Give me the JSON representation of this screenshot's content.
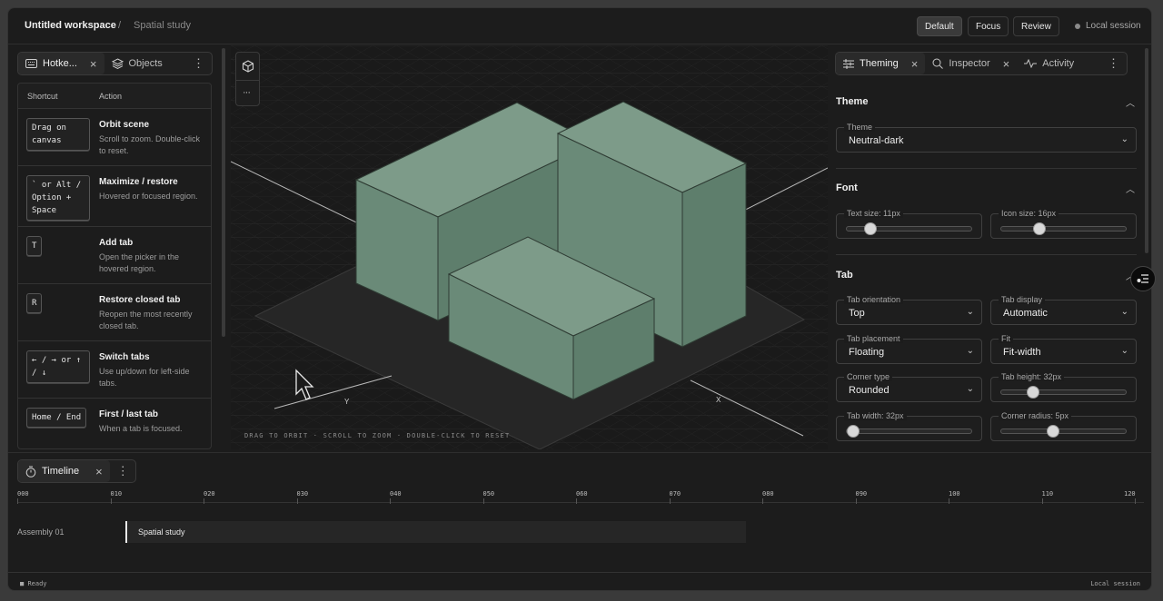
{
  "header": {
    "workspace": "Untitled workspace",
    "separator": "/",
    "project": "Spatial study",
    "modes": [
      "Default",
      "Focus",
      "Review"
    ],
    "session": "Local session"
  },
  "left": {
    "tabs": [
      {
        "label": "Hotke..."
      },
      {
        "label": "Objects"
      }
    ],
    "columns": {
      "shortcut": "Shortcut",
      "action": "Action"
    },
    "rows": [
      {
        "key": "Drag on canvas",
        "title": "Orbit scene",
        "desc": "Scroll to zoom. Double-click to reset."
      },
      {
        "key": "` or Alt / Option + Space",
        "title": "Maximize / restore",
        "desc": "Hovered or focused region."
      },
      {
        "key": "T",
        "title": "Add tab",
        "desc": "Open the picker in the hovered region."
      },
      {
        "key": "R",
        "title": "Restore closed tab",
        "desc": "Reopen the most recently closed tab."
      },
      {
        "key": "← / → or ↑ / ↓",
        "title": "Switch tabs",
        "desc": "Use up/down for left-side tabs."
      },
      {
        "key": "Home / End",
        "title": "First / last tab",
        "desc": "When a tab is focused."
      }
    ]
  },
  "viewport": {
    "hint": "DRAG TO ORBIT · SCROLL TO ZOOM · DOUBLE-CLICK TO RESET",
    "axis_x": "X",
    "axis_y": "Y",
    "box_color": "#6a8a78"
  },
  "right": {
    "tabs": [
      {
        "label": "Theming"
      },
      {
        "label": "Inspector"
      },
      {
        "label": "Activity"
      }
    ],
    "theme": {
      "title": "Theme",
      "field_label": "Theme",
      "value": "Neutral-dark"
    },
    "font": {
      "title": "Font",
      "text_size_label": "Text size: 11px",
      "text_size_level": 0.15,
      "icon_size_label": "Icon size: 16px",
      "icon_size_level": 0.28
    },
    "tab": {
      "title": "Tab",
      "orientation_label": "Tab orientation",
      "orientation": "Top",
      "display_label": "Tab display",
      "display": "Automatic",
      "placement_label": "Tab placement",
      "placement": "Floating",
      "fit_label": "Fit",
      "fit": "Fit-width",
      "corner_label": "Corner type",
      "corner": "Rounded",
      "height_label": "Tab height: 32px",
      "height_level": 0.22,
      "width_label": "Tab width: 32px",
      "width_level": 0.0,
      "radius_label": "Corner radius: 5px",
      "radius_level": 0.4
    }
  },
  "timeline": {
    "tab": "Timeline",
    "ticks": [
      "000",
      "010",
      "020",
      "030",
      "040",
      "050",
      "060",
      "070",
      "080",
      "090",
      "100",
      "110",
      "120"
    ],
    "track": "Assembly 01",
    "clip": "Spatial study"
  },
  "status": {
    "left": "Ready",
    "right": "Local session"
  }
}
